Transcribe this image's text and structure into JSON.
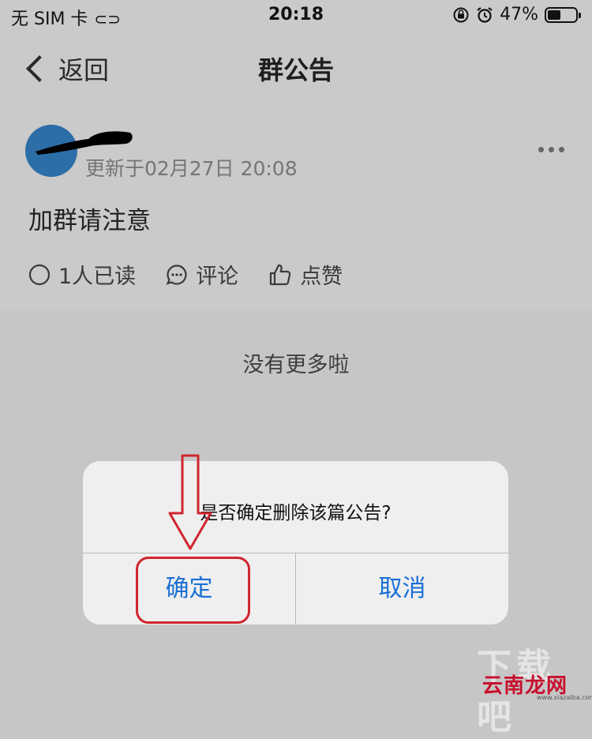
{
  "status_bar": {
    "carrier": "无 SIM 卡",
    "time": "20:18",
    "battery": "47%",
    "battery_level": 0.47,
    "icons": [
      "link-icon",
      "orientation-lock-icon",
      "alarm-icon",
      "battery-icon"
    ]
  },
  "nav": {
    "back_label": "返回",
    "title": "群公告"
  },
  "post": {
    "update_time": "更新于02月27日 20:08",
    "content": "加群请注意",
    "actions": {
      "read": "1人已读",
      "comment": "评论",
      "like": "点赞"
    }
  },
  "list_end_text": "没有更多啦",
  "dialog": {
    "message": "是否确定删除该篇公告?",
    "confirm": "确定",
    "cancel": "取消"
  },
  "watermark": {
    "brand": "云南龙网",
    "background_text": "下载吧",
    "url": "www.xiazaiba.com"
  },
  "colors": {
    "accent": "#1a6fd4",
    "highlight": "#d0262e",
    "avatar": "#2c6ea7"
  }
}
